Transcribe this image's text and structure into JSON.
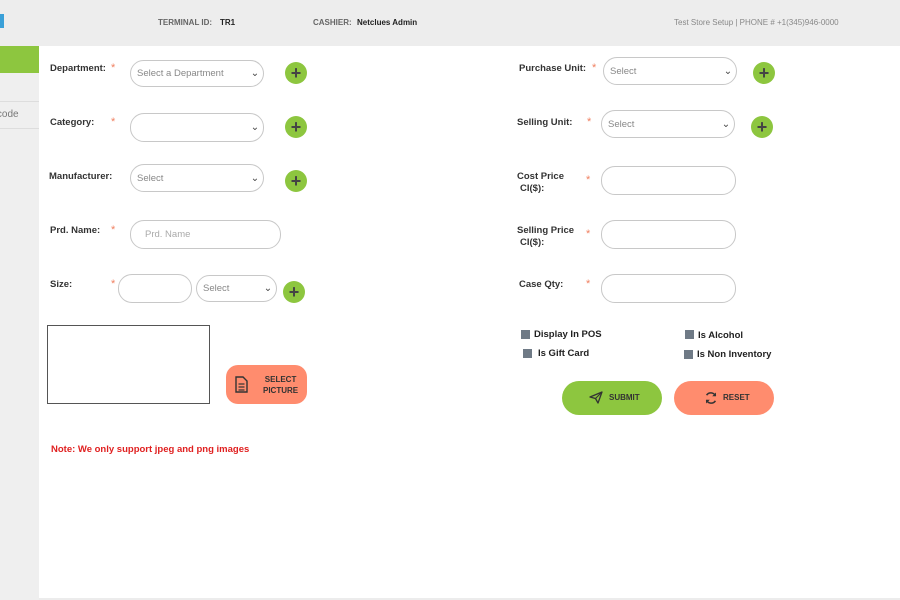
{
  "header": {
    "terminal_label": "TERMINAL ID:",
    "terminal_value": "TR1",
    "cashier_label": "CASHIER:",
    "cashier_value": "Netclues Admin",
    "store_info": "Test Store Setup | PHONE # +1(345)946-0000"
  },
  "sidebar": {
    "items": [
      {
        "label": ""
      },
      {
        "label": "arcode"
      }
    ]
  },
  "form": {
    "required_mark": "*",
    "department": {
      "label": "Department:",
      "value": "Select a Department"
    },
    "category": {
      "label": "Category:",
      "value": ""
    },
    "manufacturer": {
      "label": "Manufacturer:",
      "value": "Select"
    },
    "product_name": {
      "label": "Prd. Name:",
      "placeholder": "Prd. Name"
    },
    "size": {
      "label": "Size:",
      "unit_value": "Select"
    },
    "purchase_unit": {
      "label": "Purchase Unit:",
      "value": "Select"
    },
    "selling_unit": {
      "label": "Selling Unit:",
      "value": "Select"
    },
    "cost_price": {
      "label_line1": "Cost Price",
      "label_line2": "CI($):"
    },
    "selling_price": {
      "label_line1": "Selling Price",
      "label_line2": "CI($):"
    },
    "case_qty": {
      "label": "Case Qty:"
    },
    "plus_symbol": "+"
  },
  "checkboxes": {
    "display_in_pos": "Display In POS",
    "is_alcohol": "Is Alcohol",
    "is_gift_card": "Is Gift Card",
    "is_non_inventory": "Is Non Inventory"
  },
  "buttons": {
    "select_picture_line1": "SELECT",
    "select_picture_line2": "PICTURE",
    "submit": "SUBMIT",
    "reset": "RESET"
  },
  "note": "Note: We only support jpeg and png images",
  "colors": {
    "accent_green": "#8dc63f",
    "accent_orange": "#ff8c6e",
    "note_red": "#e02020",
    "required": "#f08060"
  },
  "icons": [
    "plus-icon",
    "chevron-down-icon",
    "document-icon",
    "send-icon",
    "refresh-icon"
  ]
}
